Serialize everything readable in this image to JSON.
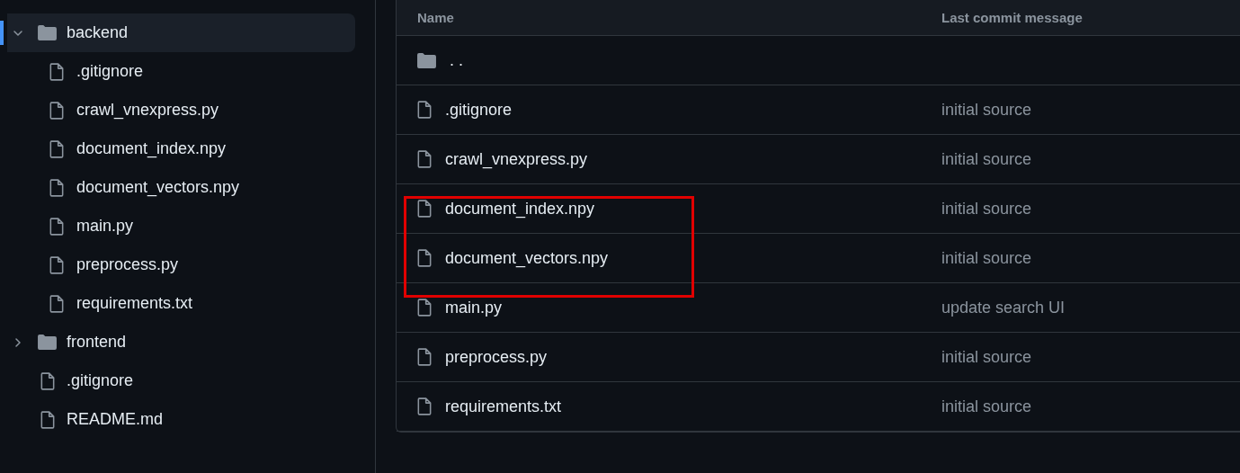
{
  "sidebar": {
    "tree": [
      {
        "kind": "folder",
        "name": "backend",
        "expanded": true,
        "selected": true,
        "children": [
          {
            "kind": "file",
            "name": ".gitignore"
          },
          {
            "kind": "file",
            "name": "crawl_vnexpress.py"
          },
          {
            "kind": "file",
            "name": "document_index.npy"
          },
          {
            "kind": "file",
            "name": "document_vectors.npy"
          },
          {
            "kind": "file",
            "name": "main.py"
          },
          {
            "kind": "file",
            "name": "preprocess.py"
          },
          {
            "kind": "file",
            "name": "requirements.txt"
          }
        ]
      },
      {
        "kind": "folder",
        "name": "frontend",
        "expanded": false,
        "selected": false
      },
      {
        "kind": "file",
        "name": ".gitignore"
      },
      {
        "kind": "file",
        "name": "README.md"
      }
    ]
  },
  "table": {
    "columns": [
      "Name",
      "Last commit message"
    ],
    "rows": [
      {
        "kind": "parent",
        "name": ". .",
        "highlighted": false
      },
      {
        "kind": "file",
        "name": ".gitignore",
        "message": "initial source",
        "highlighted": false
      },
      {
        "kind": "file",
        "name": "crawl_vnexpress.py",
        "message": "initial source",
        "highlighted": false
      },
      {
        "kind": "file",
        "name": "document_index.npy",
        "message": "initial source",
        "highlighted": true
      },
      {
        "kind": "file",
        "name": "document_vectors.npy",
        "message": "initial source",
        "highlighted": true
      },
      {
        "kind": "file",
        "name": "main.py",
        "message": "update search UI",
        "highlighted": false
      },
      {
        "kind": "file",
        "name": "preprocess.py",
        "message": "initial source",
        "highlighted": false
      },
      {
        "kind": "file",
        "name": "requirements.txt",
        "message": "initial source",
        "highlighted": false
      }
    ]
  }
}
